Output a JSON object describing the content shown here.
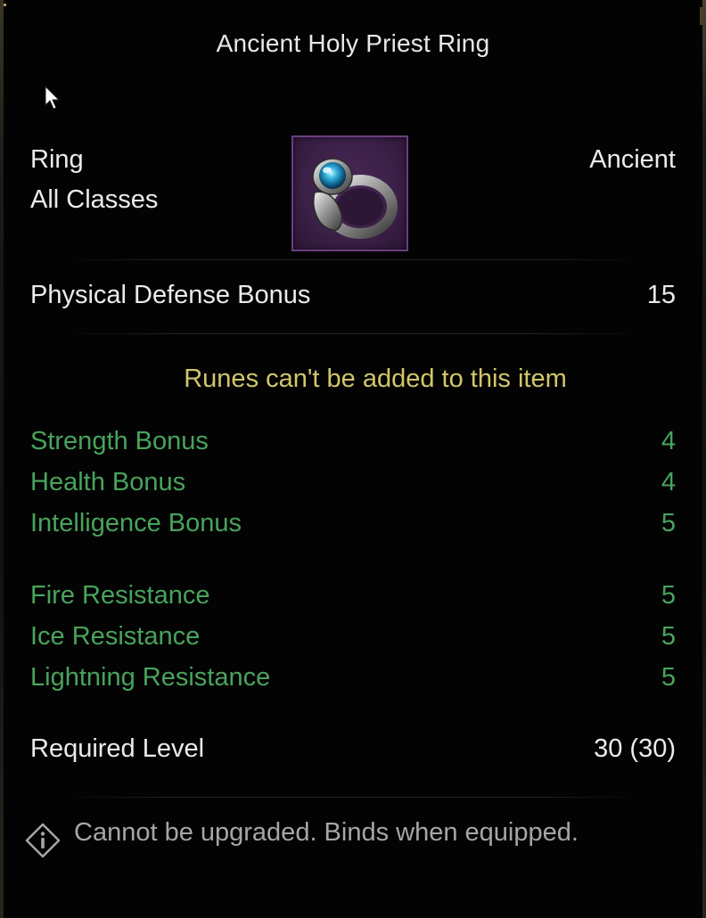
{
  "tooltip": {
    "title": "Ancient Holy Priest Ring",
    "item_type": "Ring",
    "item_class": "All Classes",
    "rarity": "Ancient",
    "item_icon": "ring-icon",
    "defense": {
      "label": "Physical Defense Bonus",
      "value": "15"
    },
    "runes_note": "Runes can't be added to this item",
    "attribute_bonuses": [
      {
        "label": "Strength Bonus",
        "value": "4"
      },
      {
        "label": "Health Bonus",
        "value": "4"
      },
      {
        "label": "Intelligence Bonus",
        "value": "5"
      }
    ],
    "resistances": [
      {
        "label": "Fire Resistance",
        "value": "5"
      },
      {
        "label": "Ice Resistance",
        "value": "5"
      },
      {
        "label": "Lightning Resistance",
        "value": "5"
      }
    ],
    "required_level": {
      "label": "Required Level",
      "value": "30 (30)"
    },
    "footer_icon": "info-diamond-icon",
    "footer_text": "Cannot be upgraded. Binds when equipped."
  },
  "colors": {
    "white_text": "#ebebeb",
    "bonus_green": "#48a35c",
    "notice_yellow": "#d2c66a",
    "footer_gray": "#a6a6a6",
    "icon_frame_purple": "#6a3e80",
    "background": "#030303"
  }
}
